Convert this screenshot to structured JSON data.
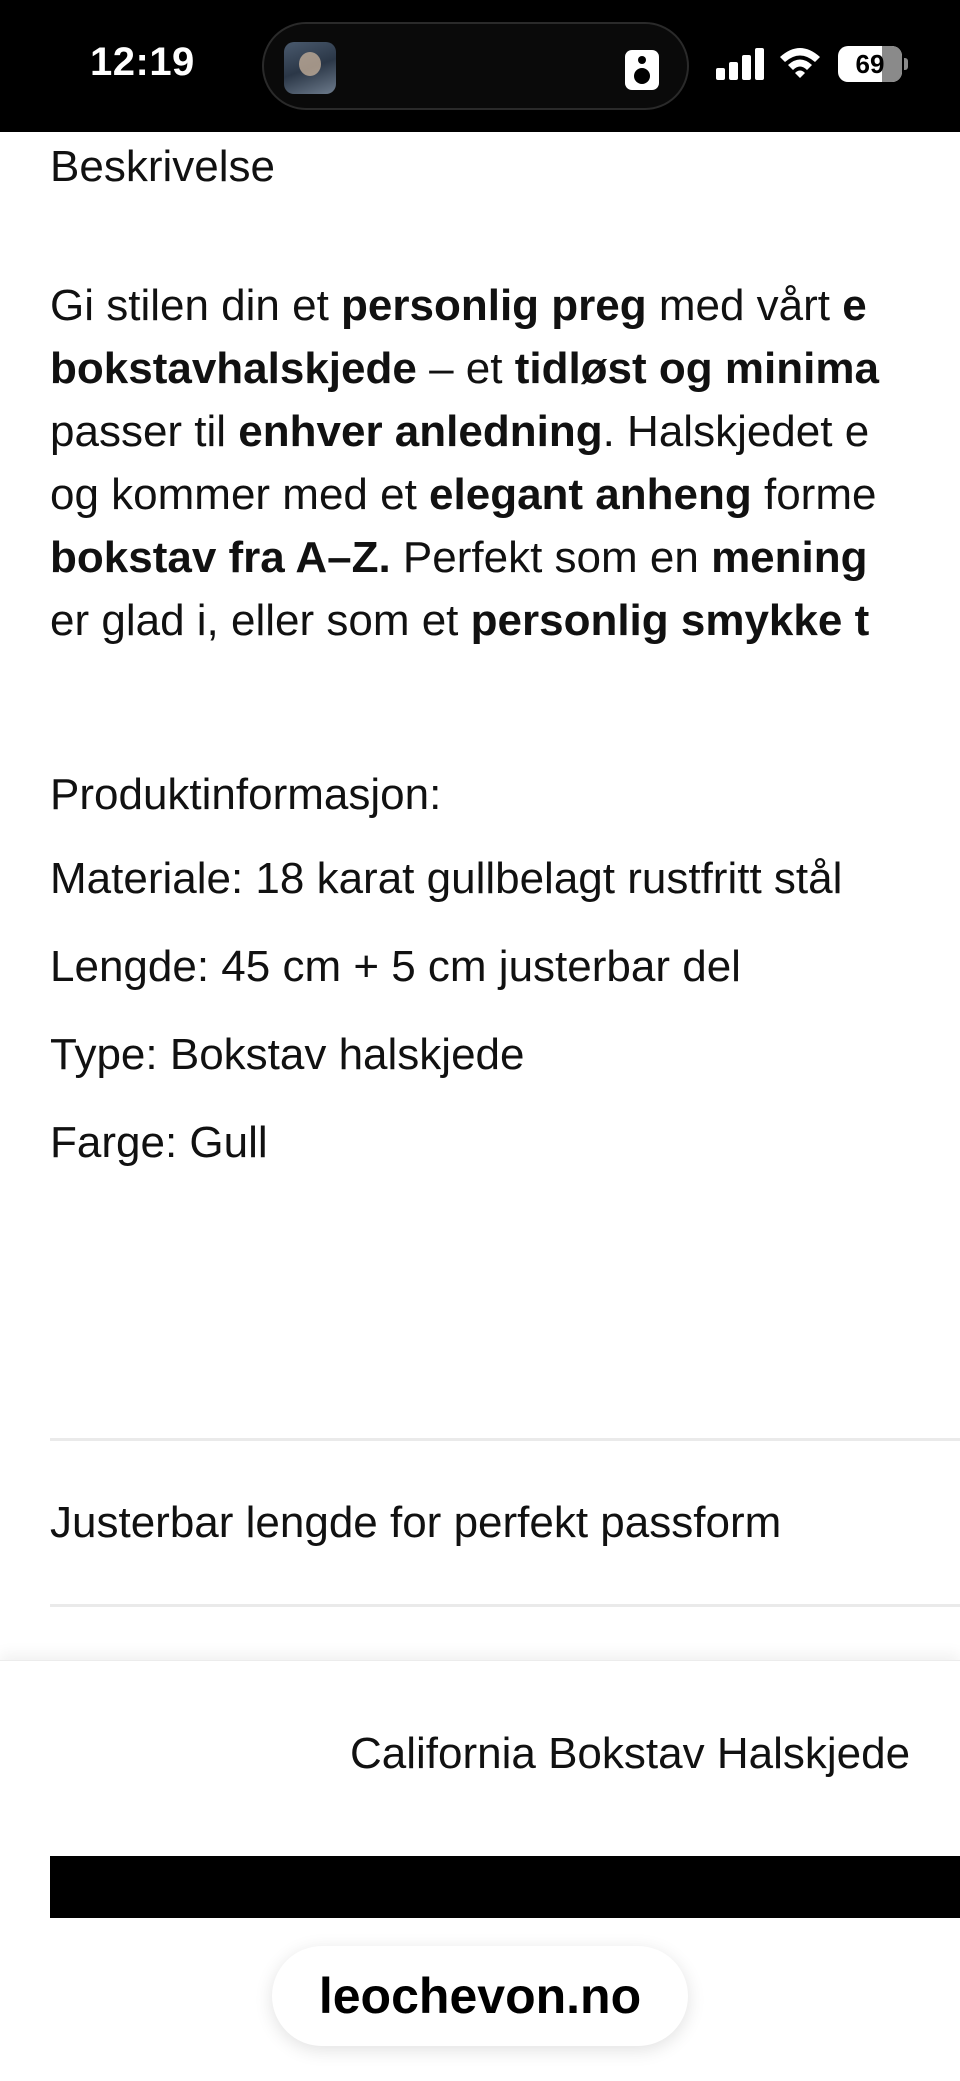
{
  "status_bar": {
    "time": "12:19",
    "battery": "69",
    "battery_fraction": 0.69
  },
  "description": {
    "heading": "Beskrivelse",
    "lines": [
      [
        {
          "t": "Gi stilen din et ",
          "b": false
        },
        {
          "t": "personlig preg",
          "b": true
        },
        {
          "t": " med vårt ",
          "b": false
        },
        {
          "t": "e",
          "b": true
        }
      ],
      [
        {
          "t": "bokstavhalskjede",
          "b": true
        },
        {
          "t": " – et ",
          "b": false
        },
        {
          "t": "tidløst og minima",
          "b": true
        }
      ],
      [
        {
          "t": "passer til ",
          "b": false
        },
        {
          "t": "enhver anledning",
          "b": true
        },
        {
          "t": ". Halskjedet e",
          "b": false
        }
      ],
      [
        {
          "t": "og kommer med et ",
          "b": false
        },
        {
          "t": "elegant anheng",
          "b": true
        },
        {
          "t": " forme",
          "b": false
        }
      ],
      [
        {
          "t": "bokstav fra A–Z.",
          "b": true
        },
        {
          "t": " Perfekt som en ",
          "b": false
        },
        {
          "t": "mening",
          "b": true
        }
      ],
      [
        {
          "t": "er glad i, eller som et ",
          "b": false
        },
        {
          "t": "personlig smykke t",
          "b": true
        }
      ]
    ]
  },
  "product_info": {
    "heading": "Produktinformasjon:",
    "material": "Materiale: 18 karat gullbelagt rustfritt stål",
    "length": "Lengde: 45 cm + 5 cm justerbar del",
    "type": "Type: Bokstav halskjede",
    "color": "Farge: Gull"
  },
  "feature": {
    "text": "Justerbar lengde for perfekt passform"
  },
  "sticky_bar": {
    "product_name": "California Bokstav Halskjede"
  },
  "browser": {
    "url": "leochevon.no"
  },
  "colors": {
    "status_bar_bg": "#000000",
    "button_bg": "#000000",
    "divider": "#eaeaea"
  }
}
